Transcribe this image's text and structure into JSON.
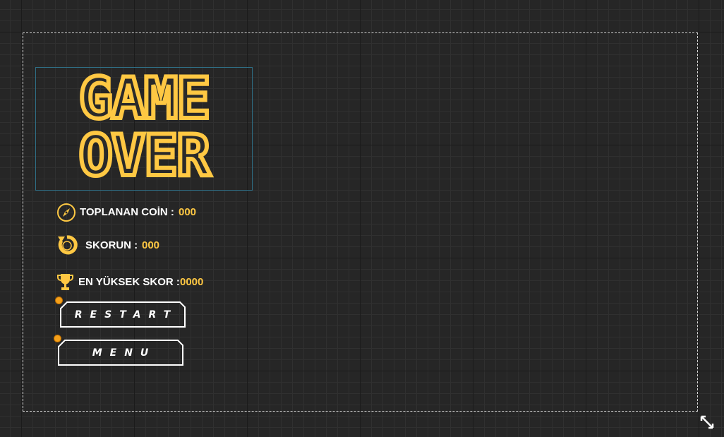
{
  "title": {
    "line1": "GAME",
    "line2": "OVER"
  },
  "stats": {
    "coins": {
      "label": "TOPLANAN COİN :",
      "value": "000",
      "icon": "compass-icon"
    },
    "score": {
      "label": "SKORUN :",
      "value": "000",
      "icon": "refresh-icon"
    },
    "high_score": {
      "label": "EN YÜKSEK SKOR :",
      "value": "0000",
      "icon": "trophy-icon"
    }
  },
  "buttons": {
    "restart": "RESTART",
    "menu": "MENU"
  },
  "colors": {
    "accent": "#ffc843",
    "background": "#262626",
    "button_border": "#ffffff",
    "anchor": "#f5a01a"
  }
}
